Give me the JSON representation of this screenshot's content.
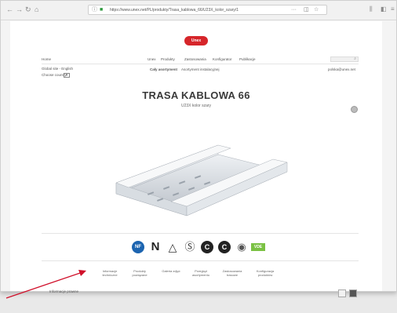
{
  "browser": {
    "url": "https://www.unex.net/PL/produkty/Trasa_kablowa_66/U23X_kolor_szary/1",
    "back": "←",
    "forward": "→",
    "reload": "↻",
    "home": "⌂",
    "more": "···",
    "star": "☆"
  },
  "site": {
    "logo": "Unex",
    "nav": {
      "home": "Home",
      "unex": "Unex",
      "produkty": "Produkty",
      "zastosowania": "Zastosowania",
      "konfigurator": "Konfigurator",
      "publikacje": "Publikacje"
    },
    "global": "Global site - English",
    "choose_country": "Choose country",
    "choose_country_btn": "▾",
    "tab_all": "Cały asortyment",
    "tab_other": "Asortyment instalacyjnej",
    "email": "polska@unex.net",
    "title": "TRASA KABLOWA 66",
    "subtitle": "U23X kolor szary",
    "certs": [
      "NF",
      "N",
      "△",
      "Ⓢ",
      "C",
      "C",
      "◉",
      "VDE"
    ],
    "bottom_links": [
      "Informacje techniczne",
      "Produkty powiązane",
      "Galeria zdjęć",
      "Przegląd asortymentu",
      "Zastosowania trasowe",
      "Konfiguracja produktów"
    ],
    "footer_left": "Informacje prawne"
  },
  "colors": {
    "brand": "#d6252a",
    "arrow": "#d0102a"
  }
}
